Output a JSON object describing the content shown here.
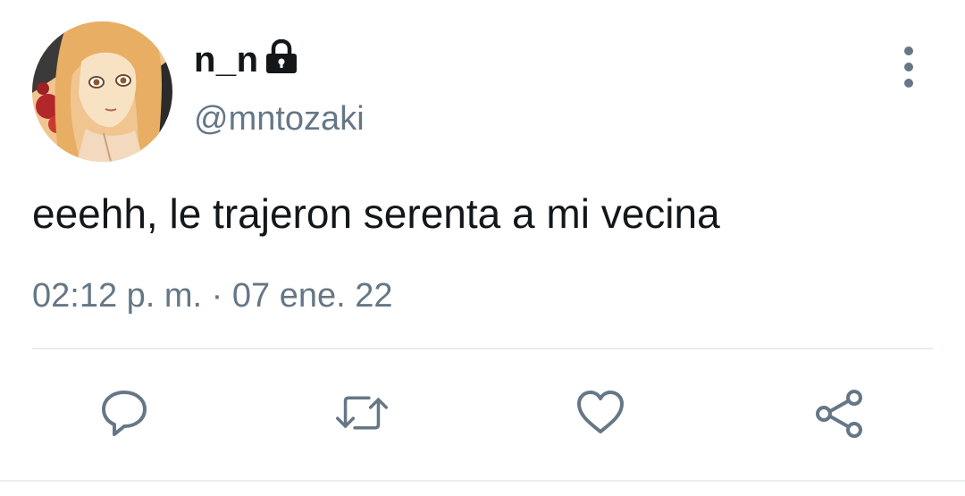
{
  "user": {
    "display_name": "n_n",
    "handle": "@mntozaki",
    "avatar_icon": "anime-avatar",
    "protected_icon": "lock-icon"
  },
  "tweet": {
    "text": "eeehh, le trajeron serenta a mi vecina",
    "timestamp": "02:12 p. m. · 07 ene. 22"
  },
  "menu": {
    "icon": "more-vertical-icon"
  },
  "actions": [
    {
      "name": "reply",
      "icon": "reply-icon"
    },
    {
      "name": "retweet",
      "icon": "retweet-icon"
    },
    {
      "name": "like",
      "icon": "heart-icon"
    },
    {
      "name": "share",
      "icon": "share-icon"
    }
  ],
  "colors": {
    "text_primary": "#14171a",
    "text_secondary": "#657786",
    "divider": "#e6ecf0",
    "background": "#ffffff"
  }
}
